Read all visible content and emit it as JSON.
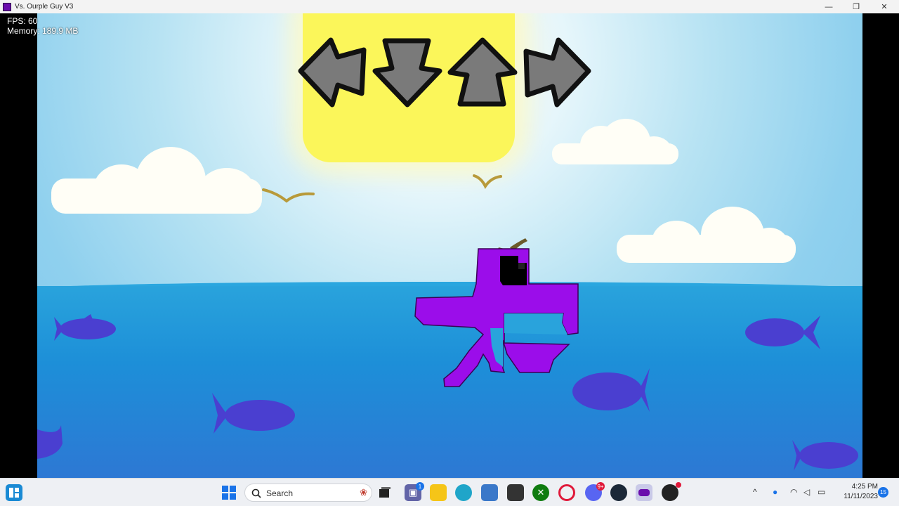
{
  "window": {
    "title": "Vs. Ourple Guy V3",
    "minimize": "—",
    "maximize": "❐",
    "close": "✕"
  },
  "overlay": {
    "fps": "FPS: 60",
    "memory": "Memory: 189.9 MB"
  },
  "game": {
    "arrows": [
      "left",
      "down",
      "up",
      "right"
    ],
    "colors": {
      "arrow_fill": "#7a7a7a",
      "arrow_outline": "#111111",
      "character": "#9b0dea",
      "fish": "#4a3fd0",
      "sun": "#fbf65a",
      "sea": "#1d8fd8"
    }
  },
  "taskbar": {
    "search_placeholder": "Search",
    "time": "4:25 PM",
    "date": "11/11/2023",
    "notification_count": "15",
    "chat_badge": "1",
    "discord_badge": "9+",
    "icons": [
      "widgets-icon",
      "start-icon",
      "search-icon",
      "task-view-icon",
      "teams-chat-icon",
      "file-explorer-icon",
      "edge-icon",
      "store-icon",
      "unity-icon",
      "xbox-icon",
      "opera-icon",
      "discord-icon",
      "steam-icon",
      "game-app-icon",
      "obs-icon"
    ]
  }
}
